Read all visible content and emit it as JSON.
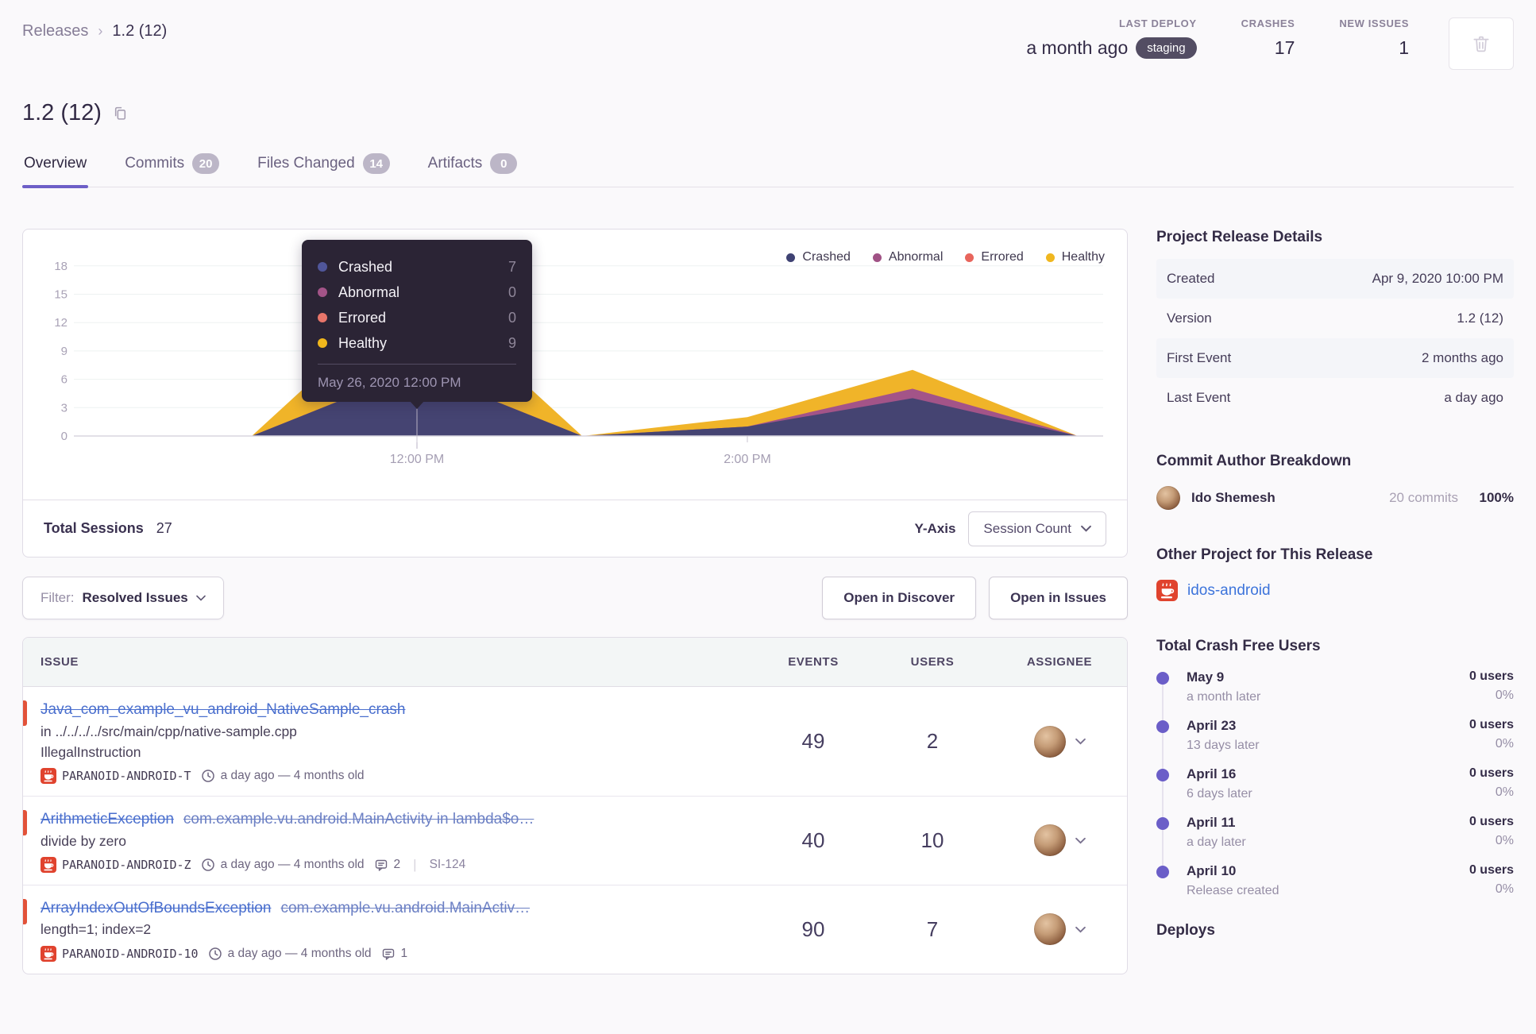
{
  "breadcrumb": {
    "parent": "Releases",
    "current": "1.2 (12)"
  },
  "header_stats": {
    "last_deploy": {
      "label": "LAST DEPLOY",
      "value": "a month ago",
      "env": "staging"
    },
    "crashes": {
      "label": "CRASHES",
      "value": "17"
    },
    "new_issues": {
      "label": "NEW ISSUES",
      "value": "1"
    }
  },
  "page_title": "1.2 (12)",
  "tabs": [
    {
      "label": "Overview",
      "badge": null,
      "active": true
    },
    {
      "label": "Commits",
      "badge": "20",
      "active": false
    },
    {
      "label": "Files Changed",
      "badge": "14",
      "active": false
    },
    {
      "label": "Artifacts",
      "badge": "0",
      "active": false
    }
  ],
  "chart_card": {
    "tooltip": {
      "rows": [
        {
          "label": "Crashed",
          "value": "7",
          "color": "#50569a"
        },
        {
          "label": "Abnormal",
          "value": "0",
          "color": "#a35488"
        },
        {
          "label": "Errored",
          "value": "0",
          "color": "#e8756a"
        },
        {
          "label": "Healthy",
          "value": "9",
          "color": "#f1b71c"
        }
      ],
      "footer": "May 26, 2020 12:00 PM"
    },
    "footer": {
      "total_sessions_label": "Total Sessions",
      "total_sessions_value": "27",
      "yaxis_label": "Y-Axis",
      "yaxis_value": "Session Count"
    }
  },
  "chart_data": {
    "type": "area",
    "stacked": true,
    "title": "Release sessions over time",
    "x_unit": "hour_of_day",
    "x": [
      10,
      11,
      12,
      13,
      14,
      15,
      16
    ],
    "series": [
      {
        "name": "Crashed",
        "color": "#454472",
        "legend_color": "#3f4273",
        "values": [
          0,
          0,
          7,
          0,
          1,
          4,
          0
        ]
      },
      {
        "name": "Abnormal",
        "color": "#a35488",
        "legend_color": "#a05285",
        "values": [
          0,
          0,
          0,
          0,
          0,
          1,
          0
        ]
      },
      {
        "name": "Errored",
        "color": "#e8655c",
        "legend_color": "#e8655c",
        "values": [
          0,
          0,
          0,
          0,
          0,
          0,
          0
        ]
      },
      {
        "name": "Healthy",
        "color": "#f0b429",
        "legend_color": "#f0b71f",
        "values": [
          0,
          0,
          9,
          0,
          1,
          2,
          0
        ]
      }
    ],
    "y_ticks": [
      0,
      3,
      6,
      9,
      12,
      15,
      18
    ],
    "ylim": [
      0,
      18
    ],
    "x_tick_labels": [
      {
        "hour": 12,
        "label": "12:00 PM"
      },
      {
        "hour": 14,
        "label": "2:00 PM"
      }
    ],
    "hover_hour": 12,
    "grid": true,
    "legend_position": "top-right"
  },
  "filter_bar": {
    "filter_prefix": "Filter:",
    "filter_value": "Resolved Issues",
    "discover_button": "Open in Discover",
    "issues_button": "Open in Issues"
  },
  "issues_table": {
    "columns": [
      "ISSUE",
      "EVENTS",
      "USERS",
      "ASSIGNEE"
    ],
    "rows": [
      {
        "title": "Java_com_example_vu_android_NativeSample_crash",
        "culprit": null,
        "location": "in ../../../../src/main/cpp/native-sample.cpp",
        "message": "IllegalInstruction",
        "project": "PARANOID-ANDROID-T",
        "age": "a day ago — 4 months old",
        "comments": null,
        "short_id": null,
        "events": "49",
        "users": "2"
      },
      {
        "title": "ArithmeticException",
        "culprit": "com.example.vu.android.MainActivity in lambda$o…",
        "location": null,
        "message": "divide by zero",
        "project": "PARANOID-ANDROID-Z",
        "age": "a day ago — 4 months old",
        "comments": "2",
        "short_id": "SI-124",
        "events": "40",
        "users": "10"
      },
      {
        "title": "ArrayIndexOutOfBoundsException",
        "culprit": "com.example.vu.android.MainActiv…",
        "location": null,
        "message": "length=1; index=2",
        "project": "PARANOID-ANDROID-10",
        "age": "a day ago — 4 months old",
        "comments": "1",
        "short_id": null,
        "events": "90",
        "users": "7"
      }
    ]
  },
  "sidebar": {
    "details": {
      "heading": "Project Release Details",
      "rows": [
        {
          "label": "Created",
          "value": "Apr 9, 2020 10:00 PM"
        },
        {
          "label": "Version",
          "value": "1.2 (12)"
        },
        {
          "label": "First Event",
          "value": "2 months ago"
        },
        {
          "label": "Last Event",
          "value": "a day ago"
        }
      ]
    },
    "commit_authors": {
      "heading": "Commit Author Breakdown",
      "author": {
        "name": "Ido Shemesh",
        "commits": "20 commits",
        "percent": "100%"
      }
    },
    "other_project": {
      "heading": "Other Project for This Release",
      "project_name": "idos-android"
    },
    "crash_free": {
      "heading": "Total Crash Free Users",
      "entries": [
        {
          "date": "May 9",
          "sub": "a month later",
          "users": "0 users",
          "percent": "0%"
        },
        {
          "date": "April 23",
          "sub": "13 days later",
          "users": "0 users",
          "percent": "0%"
        },
        {
          "date": "April 16",
          "sub": "6 days later",
          "users": "0 users",
          "percent": "0%"
        },
        {
          "date": "April 11",
          "sub": "a day later",
          "users": "0 users",
          "percent": "0%"
        },
        {
          "date": "April 10",
          "sub": "Release created",
          "users": "0 users",
          "percent": "0%"
        }
      ]
    },
    "deploys_heading": "Deploys"
  },
  "colors": {
    "accent_purple": "#6d5fc7",
    "link_blue": "#3d74db",
    "error_red": "#e25239",
    "project_icon_red": "#e0432e",
    "pill_dark": "#534d63"
  }
}
